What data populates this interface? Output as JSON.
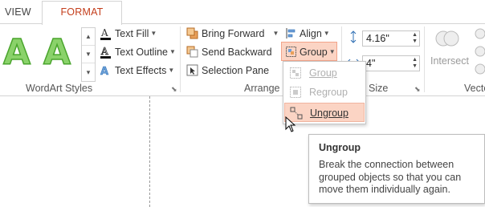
{
  "tabs": {
    "view": "VIEW",
    "format": "FORMAT"
  },
  "wordart": {
    "sample1": "A",
    "sample2": "A",
    "text_fill": "Text Fill",
    "text_outline": "Text Outline",
    "text_effects": "Text Effects",
    "group_label": "WordArt Styles"
  },
  "arrange": {
    "bring_forward": "Bring Forward",
    "send_backward": "Send Backward",
    "selection_pane": "Selection Pane",
    "align": "Align",
    "group": "Group",
    "group_label": "Arrange"
  },
  "size": {
    "height": "4.16\"",
    "width": "4\"",
    "group_label": "Size"
  },
  "vector": {
    "intersect": "Intersect",
    "group_label_partial": "Vecto"
  },
  "group_menu": {
    "items": [
      {
        "label": "Group",
        "enabled": false
      },
      {
        "label": "Regroup",
        "enabled": false
      },
      {
        "label": "Ungroup",
        "enabled": true,
        "hovered": true
      }
    ]
  },
  "tooltip": {
    "title": "Ungroup",
    "body": "Break the connection between grouped objects so that you can move them individually again."
  },
  "colors": {
    "accent": "#c43e1c",
    "hover_fill": "#fbd4c4",
    "wordart_green": "#8ad26a"
  }
}
